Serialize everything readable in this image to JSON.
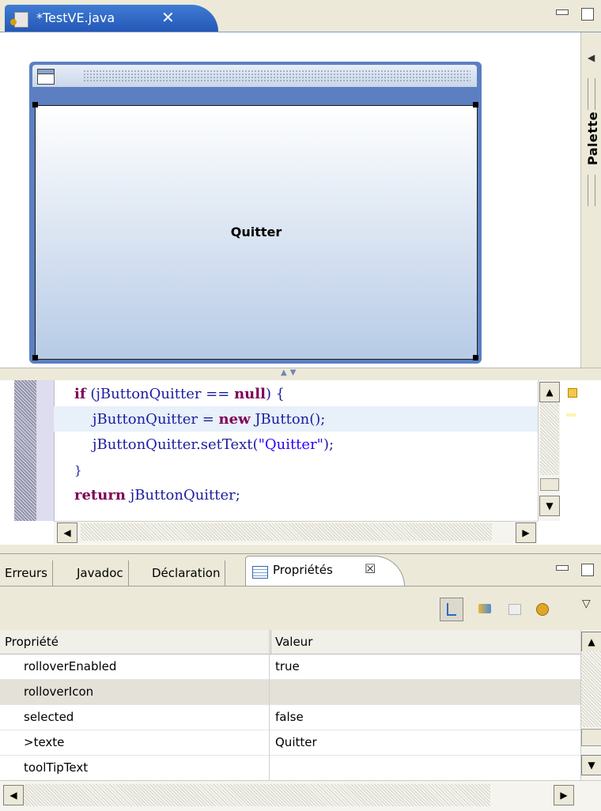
{
  "editor": {
    "tab_label": "*TestVE.java",
    "close_glyph": "✕",
    "palette_label": "Palette"
  },
  "design": {
    "button_label": "Quitter"
  },
  "code": {
    "lines": [
      {
        "kw1": "if",
        "rest": " (jButtonQuitter == ",
        "kw2": "null",
        "tail": ") {"
      },
      {
        "pre": "    jButtonQuitter = ",
        "kw": "new",
        "post": " JButton();"
      },
      {
        "pre": "    jButtonQuitter.setText(",
        "str": "\"Quitter\"",
        "post": ");"
      },
      {
        "text": "}"
      },
      {
        "kw": "return",
        "post": " jButtonQuitter;"
      }
    ]
  },
  "views": {
    "tabs": [
      "Erreurs",
      "Javadoc",
      "Déclaration"
    ],
    "active_tab": "Propriétés",
    "active_close_glyph": "☒"
  },
  "properties": {
    "headers": {
      "property": "Propriété",
      "value": "Valeur"
    },
    "rows": [
      {
        "name": "rolloverEnabled",
        "value": "true"
      },
      {
        "name": "rolloverIcon",
        "value": ""
      },
      {
        "name": "selected",
        "value": "false"
      },
      {
        "name": ">texte",
        "value": "Quitter"
      },
      {
        "name": "toolTipText",
        "value": ""
      }
    ]
  },
  "toolbar_icons": [
    "show-categories-icon",
    "show-advanced-icon",
    "restore-default-icon",
    "filter-icon",
    "view-menu-icon"
  ],
  "colors": {
    "active_tab": "#2457b8",
    "keyword": "#7f0055",
    "string": "#2a00ff",
    "code_text": "#1c1c9e"
  }
}
